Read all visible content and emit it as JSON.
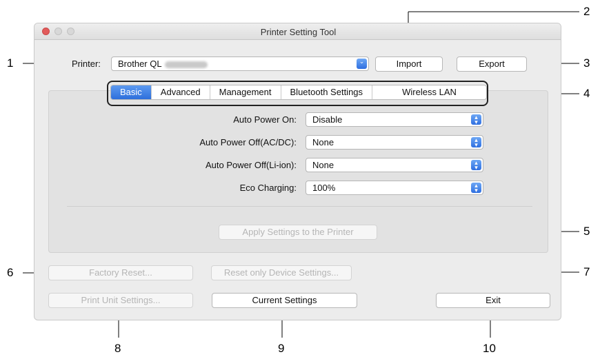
{
  "window": {
    "title": "Printer Setting Tool"
  },
  "printer": {
    "label": "Printer:",
    "value": "Brother QL",
    "value_obscured": true
  },
  "toolbar": {
    "import_label": "Import",
    "export_label": "Export"
  },
  "tabs": [
    {
      "label": "Basic",
      "active": true
    },
    {
      "label": "Advanced",
      "active": false
    },
    {
      "label": "Management",
      "active": false
    },
    {
      "label": "Bluetooth Settings",
      "active": false
    },
    {
      "label": "Wireless LAN",
      "active": false
    }
  ],
  "settings": [
    {
      "label": "Auto Power On:",
      "value": "Disable"
    },
    {
      "label": "Auto Power Off(AC/DC):",
      "value": "None"
    },
    {
      "label": "Auto Power Off(Li-ion):",
      "value": "None"
    },
    {
      "label": "Eco Charging:",
      "value": "100%"
    }
  ],
  "buttons": {
    "apply": "Apply Settings to the Printer",
    "factory_reset": "Factory Reset...",
    "reset_device": "Reset only Device Settings...",
    "print_unit": "Print Unit Settings...",
    "current": "Current Settings",
    "exit": "Exit"
  },
  "callouts": [
    "1",
    "2",
    "3",
    "4",
    "5",
    "6",
    "7",
    "8",
    "9",
    "10"
  ],
  "colors": {
    "accent": "#2f6fe0",
    "window_bg": "#ececec",
    "close_button": "#e25b5b"
  }
}
